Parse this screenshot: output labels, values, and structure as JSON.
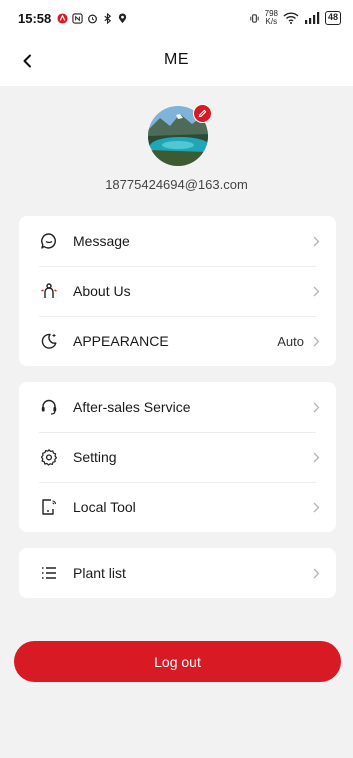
{
  "status_bar": {
    "time": "15:58",
    "network_speed_value": "798",
    "network_speed_unit": "K/s",
    "battery": "48"
  },
  "header": {
    "title": "ME"
  },
  "profile": {
    "email": "18775424694@163.com"
  },
  "group1": [
    {
      "label": "Message",
      "icon": "message-icon"
    },
    {
      "label": "About Us",
      "icon": "about-us-icon"
    },
    {
      "label": "APPEARANCE",
      "icon": "appearance-icon",
      "value": "Auto"
    }
  ],
  "group2": [
    {
      "label": "After-sales Service",
      "icon": "headset-icon"
    },
    {
      "label": "Setting",
      "icon": "gear-icon"
    },
    {
      "label": "Local Tool",
      "icon": "local-tool-icon"
    }
  ],
  "group3": [
    {
      "label": "Plant list",
      "icon": "list-icon"
    }
  ],
  "logout_label": "Log out",
  "colors": {
    "accent": "#d81a24",
    "background": "#f2f2f2",
    "card": "#ffffff"
  }
}
